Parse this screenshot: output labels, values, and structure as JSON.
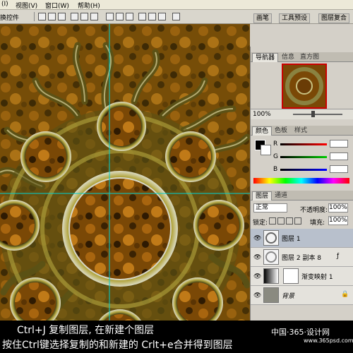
{
  "menu": {
    "items": [
      "(I)",
      "视图(V)",
      "窗口(W)",
      "帮助(H)"
    ]
  },
  "options": {
    "label": "换控件"
  },
  "wells": {
    "tabs": [
      "画笔",
      "工具预设",
      "图层复合"
    ]
  },
  "navigator": {
    "tabs": [
      "导航器",
      "信息",
      "直方图"
    ],
    "zoom": "100%"
  },
  "color": {
    "tabs": [
      "颜色",
      "色板",
      "样式"
    ],
    "channels": [
      "R",
      "G",
      "B"
    ]
  },
  "layers": {
    "tabs": [
      "图层",
      "通道"
    ],
    "blend_mode": "正常",
    "opacity_label": "不透明度:",
    "opacity": "100%",
    "lock_label": "锁定:",
    "fill_label": "填充:",
    "fill": "100%",
    "rows": [
      {
        "name": "图层 1"
      },
      {
        "name": "图层 2 副本 8"
      },
      {
        "name": "渐变映射 1"
      },
      {
        "name": "背景"
      }
    ]
  },
  "caption": {
    "line1": "Ctrl+J 复制图层, 在新建个图层",
    "line2": "按住Ctrl键选择复制的和新建的 Crlt+e合并得到图层"
  },
  "watermark": {
    "text": "中国·365·设计网",
    "url": "www.365psd.com"
  },
  "colors": {
    "gold": "#8a7a1a",
    "rust": "#8a4a0a",
    "guide": "#00d0d0"
  }
}
